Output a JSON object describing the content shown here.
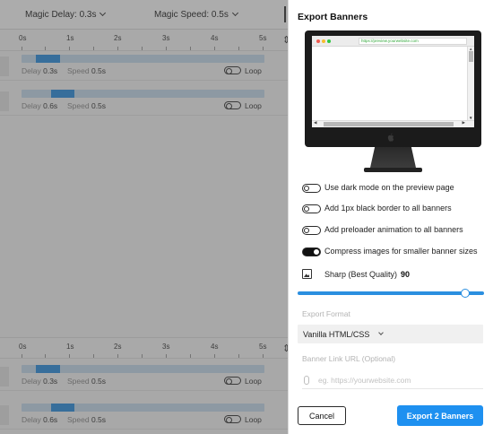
{
  "editor": {
    "magic_delay_label": "Magic Delay: 0.3s",
    "magic_speed_label": "Magic Speed: 0.5s",
    "ruler_ticks": [
      "0s",
      "1s",
      "2s",
      "3s",
      "4s",
      "5s"
    ],
    "tracks": [
      {
        "delay_label": "Delay",
        "delay": "0.3s",
        "speed_label": "Speed",
        "speed": "0.5s",
        "loop_label": "Loop"
      },
      {
        "delay_label": "Delay",
        "delay": "0.6s",
        "speed_label": "Speed",
        "speed": "0.5s",
        "loop_label": "Loop"
      },
      {
        "delay_label": "Delay",
        "delay": "0.3s",
        "speed_label": "Speed",
        "speed": "0.5s",
        "loop_label": "Loop"
      },
      {
        "delay_label": "Delay",
        "delay": "0.6s",
        "speed_label": "Speed",
        "speed": "0.5s",
        "loop_label": "Loop"
      }
    ]
  },
  "panel": {
    "title": "Export Banners",
    "preview_url": "https://preview.yourwebsite.com",
    "options": [
      {
        "label": "Use dark mode on the preview page",
        "on": false
      },
      {
        "label": "Add 1px black border to all banners",
        "on": false
      },
      {
        "label": "Add preloader animation to all banners",
        "on": false
      },
      {
        "label": "Compress images for smaller banner sizes",
        "on": true
      }
    ],
    "quality_label": "Sharp (Best Quality)",
    "quality_value": "90",
    "quality_level": 0.9,
    "export_format_label": "Export Format",
    "export_format_value": "Vanilla HTML/CSS",
    "link_label": "Banner Link URL (Optional)",
    "link_placeholder": "eg. https://yourwebsite.com",
    "link_value": "",
    "cancel_label": "Cancel",
    "export_label": "Export 2 Banners",
    "accent_color": "#1e90f0"
  }
}
